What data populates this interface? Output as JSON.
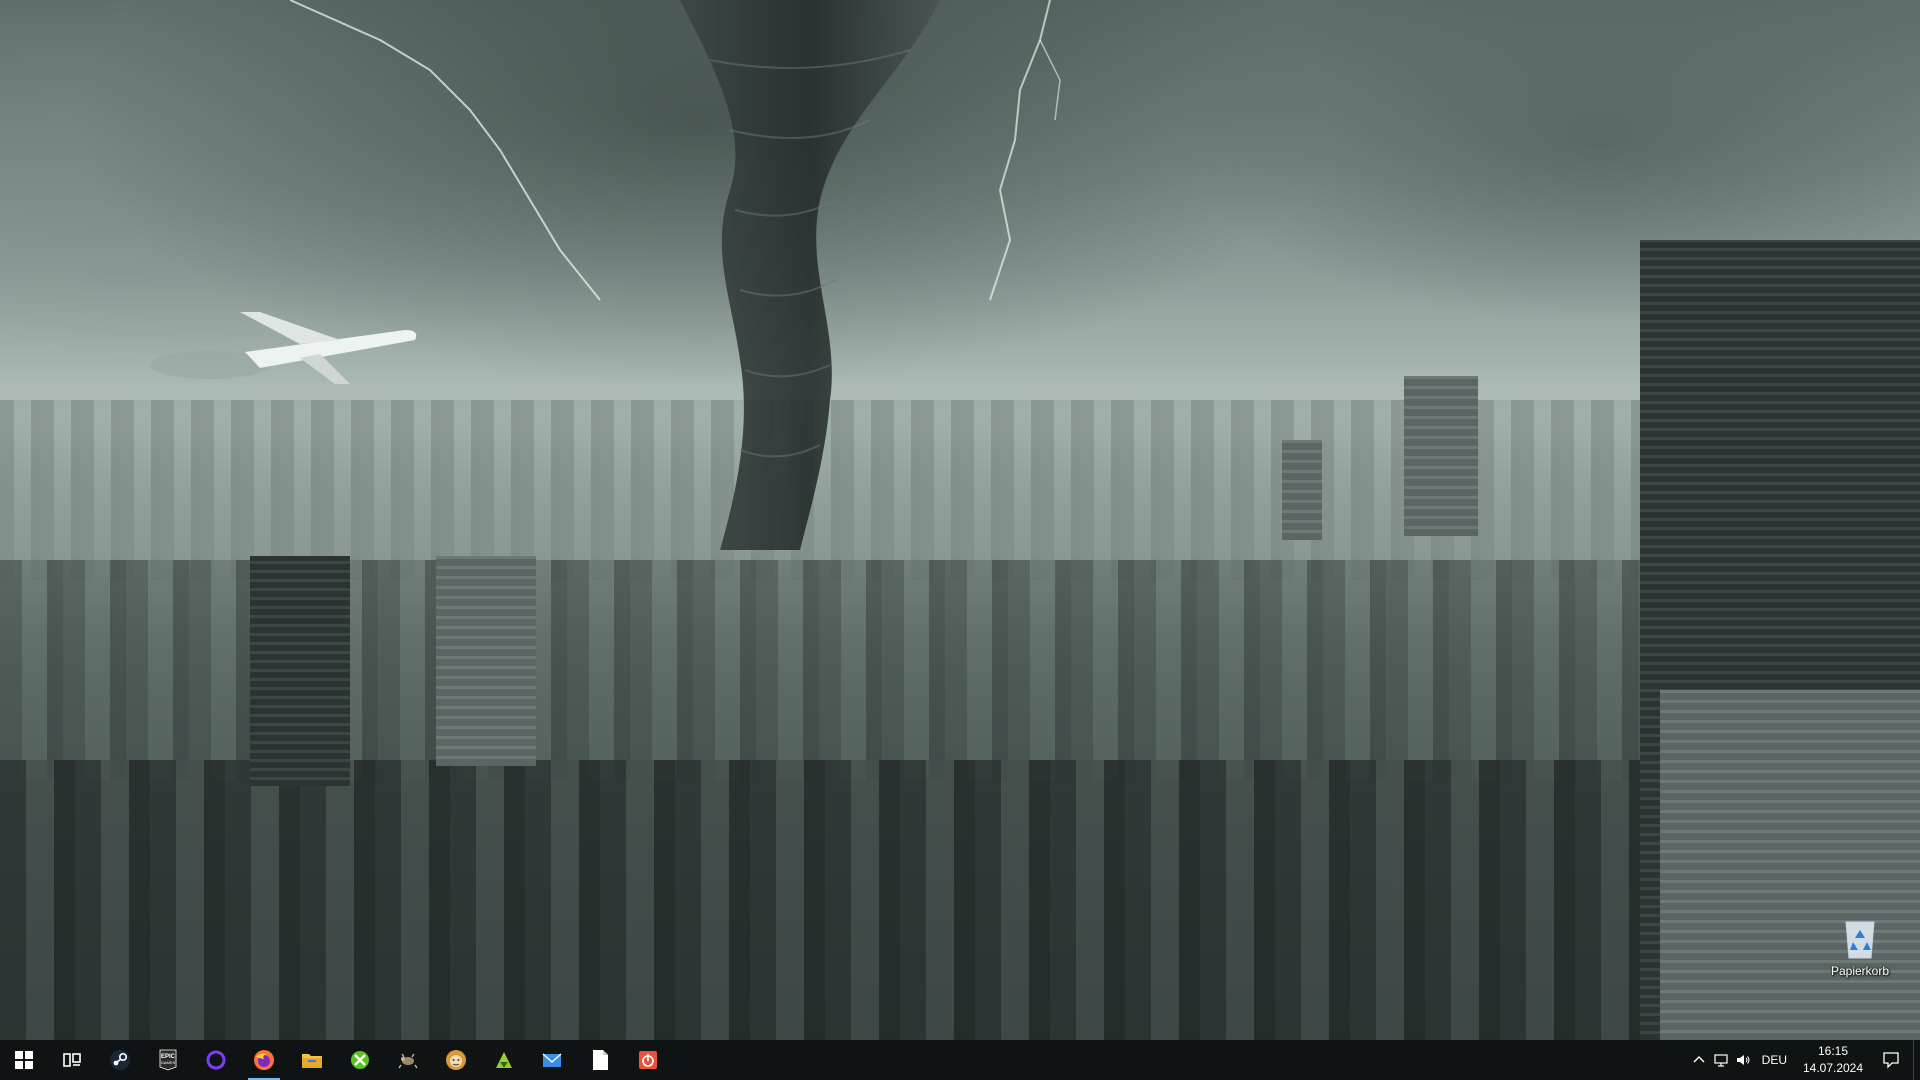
{
  "desktop": {
    "wallpaper": "tornado-over-city",
    "icons": [
      {
        "label": "Papierkorb",
        "icon": "recycle-bin-icon"
      }
    ]
  },
  "taskbar": {
    "start": {
      "icon": "windows-start-icon"
    },
    "task_view": {
      "icon": "task-view-icon"
    },
    "apps": [
      {
        "name": "steam",
        "icon": "steam-icon",
        "color": "#1b2838"
      },
      {
        "name": "epic-games",
        "icon": "epic-games-icon",
        "color": "#2b2b2b"
      },
      {
        "name": "cortana",
        "icon": "cortana-ring-icon",
        "color": "#7a3ff0"
      },
      {
        "name": "firefox",
        "icon": "firefox-icon",
        "color": "#ff7139"
      },
      {
        "name": "file-explorer",
        "icon": "folder-icon",
        "color": "#f4c14a"
      },
      {
        "name": "xbox",
        "icon": "xbox-icon",
        "color": "#5dc21e"
      },
      {
        "name": "game-app",
        "icon": "bug-icon",
        "color": "#9a8a6a"
      },
      {
        "name": "character-app",
        "icon": "character-face-icon",
        "color": "#d99a3a"
      },
      {
        "name": "app-green",
        "icon": "green-launcher-icon",
        "color": "#9acd32"
      },
      {
        "name": "mail",
        "icon": "mail-icon",
        "color": "#3a8ee6"
      },
      {
        "name": "notepad",
        "icon": "document-icon",
        "color": "#ffffff"
      },
      {
        "name": "power-app",
        "icon": "power-icon",
        "color": "#e8533a"
      }
    ],
    "epic_text": "EPIC\nGAMES",
    "tray": {
      "icons": [
        "chevron-up-icon",
        "network-icon",
        "speaker-icon"
      ],
      "language": "DEU",
      "time": "16:15",
      "date": "14.07.2024",
      "notification_icon": "action-center-icon"
    }
  }
}
